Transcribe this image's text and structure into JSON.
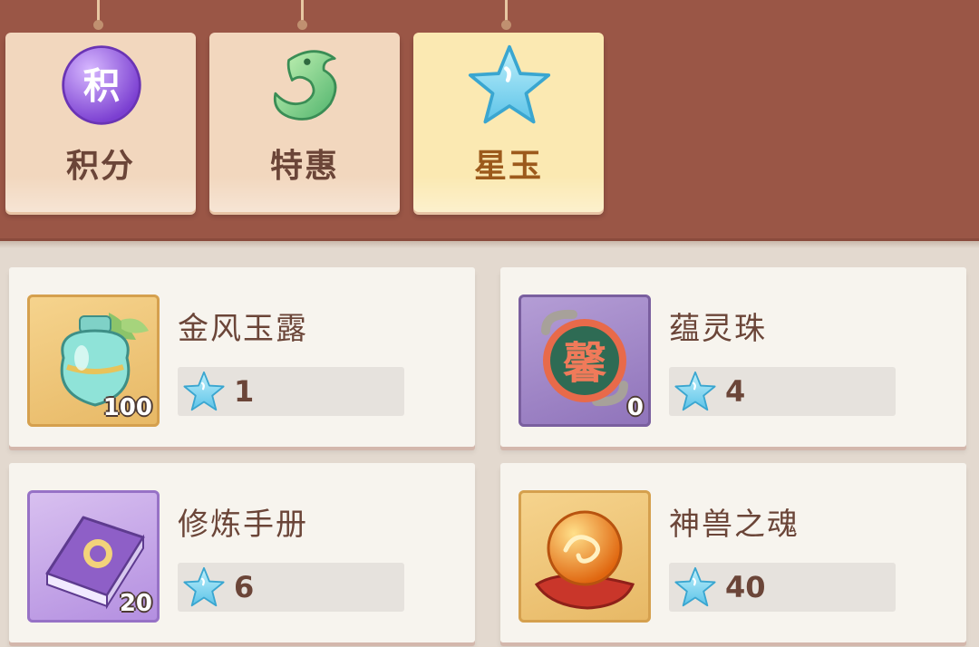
{
  "tabs": [
    {
      "label": "积分",
      "icon_text": "积",
      "icon": "points-orb-icon",
      "active": false
    },
    {
      "label": "特惠",
      "icon": "jade-dragon-icon",
      "active": false
    },
    {
      "label": "星玉",
      "icon": "star-jade-icon",
      "active": true
    }
  ],
  "items": [
    {
      "name": "金风玉露",
      "count": "100",
      "price": "1",
      "icon": "potion-bottle-icon"
    },
    {
      "name": "蕴灵珠",
      "count": "0",
      "price": "4",
      "icon_text": "馨",
      "icon": "spirit-orb-icon"
    },
    {
      "name": "修炼手册",
      "count": "20",
      "price": "6",
      "icon": "training-manual-icon"
    },
    {
      "name": "神兽之魂",
      "count": "",
      "price": "40",
      "icon": "beast-soul-orb-icon"
    }
  ],
  "colors": {
    "header_bg": "#9a5646",
    "tab_bg": "#f2d7be",
    "tab_active_bg": "#fbe9b2",
    "panel_bg": "#f7f4ee",
    "text": "#6b4538"
  }
}
